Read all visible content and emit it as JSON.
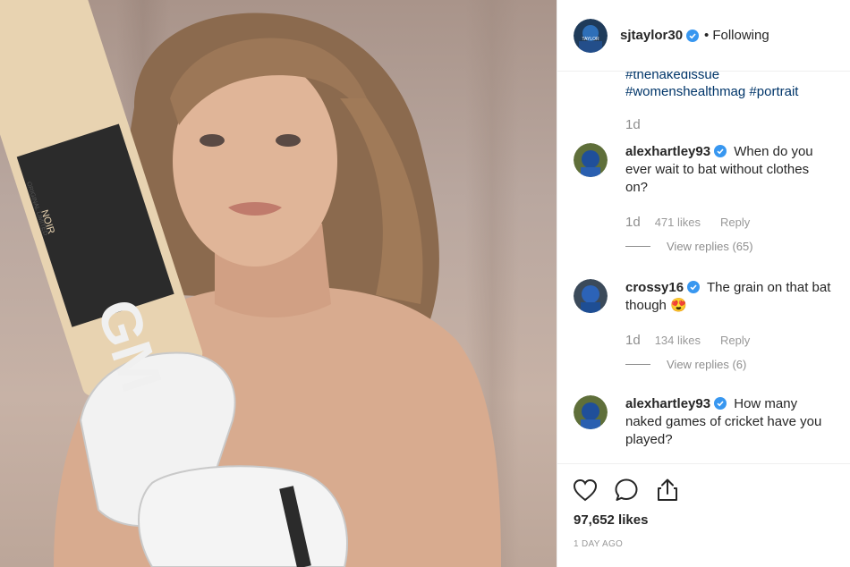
{
  "post": {
    "author": "sjtaylor30",
    "follow_status": "Following",
    "separator": "•",
    "avatar_text": "TAYLOR",
    "photo": {
      "bat_brand": "GM",
      "bat_model": "NOIR",
      "bat_edition": "ORIGINAL LIMITED"
    }
  },
  "caption": {
    "tag1": "#thenakedissue",
    "tag2": "#womenshealthmag",
    "tag3": "#portrait",
    "time": "1d"
  },
  "comments": [
    {
      "username": "alexhartley93",
      "text": "When do you ever wait to bat without clothes on?",
      "age": "1d",
      "likes": "471 likes",
      "reply": "Reply",
      "view_replies": "View replies (65)"
    },
    {
      "username": "crossy16",
      "text": "The grain on that bat though",
      "emoji": "😍",
      "age": "1d",
      "likes": "134 likes",
      "reply": "Reply",
      "view_replies": "View replies (6)"
    },
    {
      "username": "alexhartley93",
      "text": "How many naked games of cricket have you played?"
    }
  ],
  "footer": {
    "likes": "97,652 likes",
    "date": "1 DAY AGO"
  },
  "icons": {
    "like": "heart-icon",
    "comment": "comment-icon",
    "share": "share-icon",
    "verified": "verified-badge-icon"
  },
  "colors": {
    "verified": "#3897f0",
    "hashtag": "#003569",
    "muted": "#8e8e8e"
  }
}
